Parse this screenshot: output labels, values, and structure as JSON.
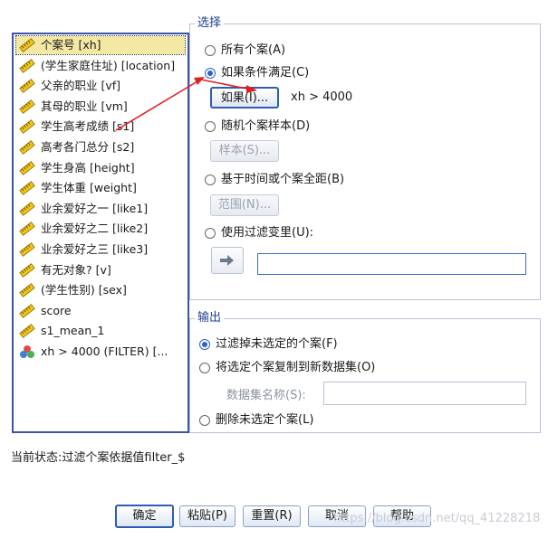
{
  "variables": [
    {
      "label": "个案号 [xh]",
      "icon": "ruler-icon"
    },
    {
      "label": "(学生家庭住址) [location]",
      "icon": "ruler-icon"
    },
    {
      "label": "父亲的职业 [vf]",
      "icon": "ruler-icon"
    },
    {
      "label": "其母的职业 [vm]",
      "icon": "ruler-icon"
    },
    {
      "label": "学生高考成绩 [s1]",
      "icon": "ruler-icon"
    },
    {
      "label": "高考各门总分 [s2]",
      "icon": "ruler-icon"
    },
    {
      "label": "学生身高 [height]",
      "icon": "ruler-icon"
    },
    {
      "label": "学生体重 [weight]",
      "icon": "ruler-icon"
    },
    {
      "label": "业余爱好之一 [like1]",
      "icon": "ruler-icon"
    },
    {
      "label": "业余爱好之二 [like2]",
      "icon": "ruler-icon"
    },
    {
      "label": "业余爱好之三 [like3]",
      "icon": "ruler-icon"
    },
    {
      "label": "有无对象? [v]",
      "icon": "ruler-icon"
    },
    {
      "label": "(学生性别) [sex]",
      "icon": "ruler-icon"
    },
    {
      "label": "score",
      "icon": "ruler-icon"
    },
    {
      "label": "s1_mean_1",
      "icon": "ruler-icon"
    },
    {
      "label": "xh > 4000 (FILTER) [...",
      "icon": "nominal-icon"
    }
  ],
  "select": {
    "title": "选择",
    "all_cases": "所有个案(A)",
    "if_condition": "如果条件满足(C)",
    "if_button": "如果(I)...",
    "condition_text": "xh > 4000",
    "random_sample": "随机个案样本(D)",
    "sample_button": "样本(S)...",
    "time_range": "基于时间或个案全距(B)",
    "range_button": "范围(N)...",
    "filter_variable": "使用过滤变里(U):",
    "filter_value": ""
  },
  "output": {
    "title": "输出",
    "filter_out": "过滤掉未选定的个案(F)",
    "copy_to_new": "将选定个案复制到新数据集(O)",
    "dataset_name_label": "数据集名称(S):",
    "dataset_name_value": "",
    "delete_unselected": "删除未选定个案(L)"
  },
  "status": "当前状态:过滤个案依据值filter_$",
  "buttons": {
    "ok": "确定",
    "paste": "粘贴(P)",
    "reset": "重置(R)",
    "cancel": "取消",
    "help": "帮助"
  },
  "watermark": "https://blog.csdn.net/qq_41228218",
  "colors": {
    "accent": "#2b63c7",
    "annotation_arrow": "#e02020",
    "selected_row": "#f3e8a4"
  }
}
